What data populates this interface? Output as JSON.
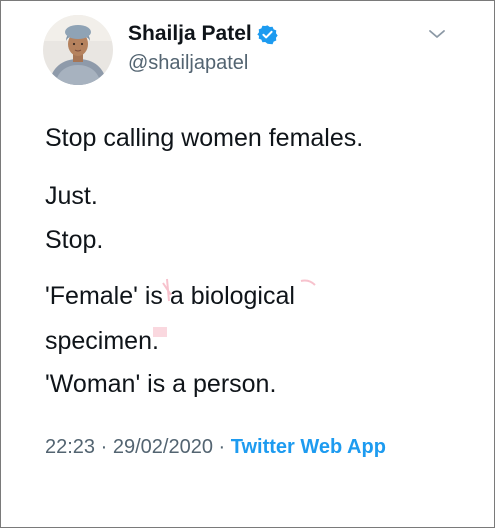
{
  "tweet": {
    "author": {
      "display_name": "Shailja Patel",
      "handle": "@shailjapatel",
      "verified": true
    },
    "text_lines": [
      "Stop calling women females.",
      "Just.",
      "Stop.",
      "'Female' is a biological",
      "specimen.",
      "'Woman' is a person."
    ],
    "time": "22:23",
    "separator": " · ",
    "date": "29/02/2020",
    "source": "Twitter Web App"
  },
  "icons": {
    "verified": "verified-badge-icon",
    "menu": "chevron-down-icon"
  },
  "colors": {
    "accent": "#1d9bf0",
    "text": "#0f1419",
    "secondary": "#536471",
    "border": "#7a7a7a"
  }
}
